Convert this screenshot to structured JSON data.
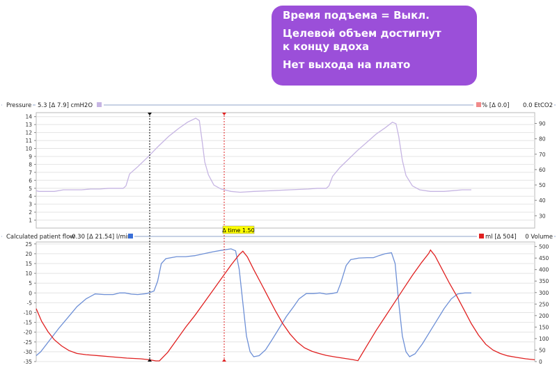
{
  "callout": {
    "lines": [
      "Время подъема = Выкл.",
      "Целевой объем достигнут\nк концу вдоха",
      "Нет выхода на плато"
    ],
    "background": "#9b4fd9"
  },
  "pressure_panel": {
    "left_header": "Pressure",
    "left_readout": "5.3 [Δ  7.9] cmH2O",
    "right_readout": "% [Δ  0.0]",
    "right_label": "0.0 EtCO2"
  },
  "flow_panel": {
    "left_header": "Calculated patient flow",
    "left_readout": "-0.30 [Δ 21.54] l/min",
    "right_readout": "ml [Δ  504]",
    "right_label": "0 Volume"
  },
  "cursor_badge": "Δ time 1.50",
  "colors": {
    "pressure": "#c6b5e3",
    "flow": "#6d8fd6",
    "volume": "#e02020",
    "pressure_marker": "#c6b5e3",
    "etco2_marker": "#f08a8a",
    "flow_marker": "#3a6fd8",
    "volume_marker": "#e02020",
    "badge": "#ffff00"
  },
  "chart_data": [
    {
      "type": "line",
      "title": "Pressure",
      "ylim": [
        0,
        14.5
      ],
      "yticks": [
        1,
        2,
        3,
        4,
        5,
        6,
        7,
        8,
        9,
        10,
        11,
        12,
        13,
        14
      ],
      "y2lim": [
        22,
        97
      ],
      "y2ticks": [
        30,
        40,
        50,
        60,
        70,
        80,
        90
      ],
      "grid": true,
      "series": [
        {
          "name": "Pressure",
          "units": "cmH2O",
          "points": [
            [
              0,
              4.7
            ],
            [
              0.3,
              4.6
            ],
            [
              1.0,
              4.6
            ],
            [
              2.0,
              4.6
            ],
            [
              3.0,
              4.8
            ],
            [
              5.0,
              4.8
            ],
            [
              6.0,
              4.9
            ],
            [
              7.0,
              4.9
            ],
            [
              8.0,
              5.0
            ],
            [
              9.0,
              5.0
            ],
            [
              9.6,
              5.0
            ],
            [
              9.9,
              5.3
            ],
            [
              10.3,
              6.8
            ],
            [
              11.2,
              7.7
            ],
            [
              12.3,
              8.9
            ],
            [
              13.5,
              10.3
            ],
            [
              14.6,
              11.5
            ],
            [
              15.7,
              12.5
            ],
            [
              16.7,
              13.3
            ],
            [
              17.6,
              13.8
            ],
            [
              18.0,
              13.5
            ],
            [
              18.3,
              11.0
            ],
            [
              18.6,
              8.3
            ],
            [
              19.0,
              6.7
            ],
            [
              19.6,
              5.4
            ],
            [
              20.4,
              4.9
            ],
            [
              21.5,
              4.6
            ],
            [
              22.5,
              4.5
            ],
            [
              24.0,
              4.6
            ],
            [
              26.0,
              4.7
            ],
            [
              28.0,
              4.8
            ],
            [
              30.0,
              4.9
            ],
            [
              31.0,
              5.0
            ],
            [
              32.0,
              5.0
            ],
            [
              32.3,
              5.3
            ],
            [
              32.7,
              6.5
            ],
            [
              33.5,
              7.6
            ],
            [
              34.5,
              8.7
            ],
            [
              35.5,
              9.8
            ],
            [
              36.5,
              10.8
            ],
            [
              37.5,
              11.8
            ],
            [
              38.5,
              12.6
            ],
            [
              39.3,
              13.3
            ],
            [
              39.7,
              13.1
            ],
            [
              40.0,
              11.5
            ],
            [
              40.4,
              8.5
            ],
            [
              40.8,
              6.6
            ],
            [
              41.5,
              5.3
            ],
            [
              42.3,
              4.8
            ],
            [
              43.5,
              4.6
            ],
            [
              45.0,
              4.6
            ],
            [
              46.0,
              4.7
            ],
            [
              47.0,
              4.8
            ],
            [
              48.0,
              4.8
            ]
          ]
        }
      ]
    },
    {
      "type": "line",
      "title": "Calculated patient flow",
      "ylim": [
        -35,
        26
      ],
      "yticks": [
        -35,
        -30,
        -25,
        -20,
        -15,
        -10,
        -5,
        0,
        5,
        10,
        15,
        20,
        25
      ],
      "y2lim": [
        0,
        520
      ],
      "y2ticks": [
        0,
        50,
        100,
        150,
        200,
        250,
        300,
        350,
        400,
        450,
        500
      ],
      "grid": true,
      "series": [
        {
          "name": "Calculated patient flow",
          "units": "l/min",
          "points": [
            [
              0,
              -32
            ],
            [
              0.5,
              -30
            ],
            [
              1.5,
              -24
            ],
            [
              2.5,
              -18
            ],
            [
              3.5,
              -12.5
            ],
            [
              4.5,
              -7
            ],
            [
              5.5,
              -3
            ],
            [
              6.5,
              -0.5
            ],
            [
              7.5,
              -0.8
            ],
            [
              8.5,
              -0.8
            ],
            [
              9.2,
              0
            ],
            [
              9.8,
              0
            ],
            [
              10.5,
              -0.6
            ],
            [
              11.2,
              -0.8
            ],
            [
              12.2,
              -0.3
            ],
            [
              13.0,
              1
            ],
            [
              13.4,
              6
            ],
            [
              13.8,
              15
            ],
            [
              14.3,
              17.5
            ],
            [
              15.5,
              18.5
            ],
            [
              16.5,
              18.5
            ],
            [
              17.5,
              19
            ],
            [
              18.5,
              20
            ],
            [
              19.5,
              21
            ],
            [
              20.5,
              21.8
            ],
            [
              21.5,
              22.5
            ],
            [
              22.0,
              21.5
            ],
            [
              22.4,
              12
            ],
            [
              22.8,
              -5
            ],
            [
              23.2,
              -22
            ],
            [
              23.6,
              -30
            ],
            [
              24.0,
              -32.5
            ],
            [
              24.6,
              -32
            ],
            [
              25.3,
              -29
            ],
            [
              26.0,
              -24
            ],
            [
              26.8,
              -18
            ],
            [
              27.6,
              -12
            ],
            [
              28.4,
              -7
            ],
            [
              29.0,
              -3
            ],
            [
              29.8,
              -0.3
            ],
            [
              30.6,
              -0.3
            ],
            [
              31.3,
              0
            ],
            [
              32.0,
              -0.6
            ],
            [
              32.6,
              -0.3
            ],
            [
              33.2,
              0.2
            ],
            [
              33.6,
              5
            ],
            [
              34.2,
              14
            ],
            [
              34.7,
              17
            ],
            [
              35.6,
              17.8
            ],
            [
              36.5,
              18
            ],
            [
              37.2,
              18
            ],
            [
              37.8,
              19
            ],
            [
              38.5,
              20
            ],
            [
              39.2,
              20.5
            ],
            [
              39.6,
              15
            ],
            [
              40.0,
              -5
            ],
            [
              40.4,
              -22
            ],
            [
              40.8,
              -30
            ],
            [
              41.2,
              -32.5
            ],
            [
              41.8,
              -31
            ],
            [
              42.6,
              -26
            ],
            [
              43.4,
              -20
            ],
            [
              44.2,
              -14
            ],
            [
              45.0,
              -8
            ],
            [
              45.8,
              -3
            ],
            [
              46.5,
              -0.5
            ],
            [
              47.3,
              0
            ],
            [
              48.0,
              0
            ]
          ]
        },
        {
          "name": "Volume",
          "units": "ml",
          "points": [
            [
              0,
              230
            ],
            [
              0.6,
              175
            ],
            [
              1.3,
              130
            ],
            [
              2.0,
              95
            ],
            [
              2.8,
              68
            ],
            [
              3.6,
              48
            ],
            [
              4.5,
              35
            ],
            [
              5.5,
              30
            ],
            [
              7.0,
              25
            ],
            [
              8.5,
              20
            ],
            [
              10.0,
              15
            ],
            [
              11.5,
              12
            ],
            [
              12.5,
              8
            ],
            [
              13.2,
              3
            ],
            [
              13.6,
              3
            ],
            [
              14.5,
              40
            ],
            [
              15.5,
              95
            ],
            [
              16.5,
              150
            ],
            [
              17.5,
              200
            ],
            [
              18.5,
              255
            ],
            [
              19.5,
              310
            ],
            [
              20.5,
              365
            ],
            [
              21.5,
              420
            ],
            [
              22.4,
              465
            ],
            [
              22.8,
              480
            ],
            [
              23.3,
              455
            ],
            [
              24.0,
              400
            ],
            [
              24.8,
              340
            ],
            [
              25.6,
              280
            ],
            [
              26.4,
              220
            ],
            [
              27.2,
              165
            ],
            [
              28.0,
              120
            ],
            [
              28.8,
              85
            ],
            [
              29.6,
              60
            ],
            [
              30.4,
              45
            ],
            [
              31.2,
              35
            ],
            [
              32.0,
              27
            ],
            [
              33.0,
              20
            ],
            [
              34.0,
              14
            ],
            [
              35.0,
              8
            ],
            [
              35.5,
              4
            ],
            [
              36.5,
              70
            ],
            [
              37.5,
              135
            ],
            [
              38.5,
              195
            ],
            [
              39.5,
              255
            ],
            [
              40.5,
              315
            ],
            [
              41.5,
              375
            ],
            [
              42.5,
              430
            ],
            [
              43.3,
              470
            ],
            [
              43.5,
              485
            ],
            [
              44.0,
              460
            ],
            [
              44.8,
              400
            ],
            [
              45.6,
              340
            ],
            [
              46.4,
              285
            ],
            [
              47.2,
              225
            ],
            [
              48.0,
              165
            ],
            [
              48.8,
              115
            ],
            [
              49.6,
              75
            ],
            [
              50.4,
              50
            ],
            [
              51.2,
              35
            ],
            [
              52.0,
              25
            ],
            [
              53.0,
              18
            ],
            [
              54.0,
              12
            ],
            [
              55.0,
              8
            ]
          ]
        }
      ]
    }
  ]
}
